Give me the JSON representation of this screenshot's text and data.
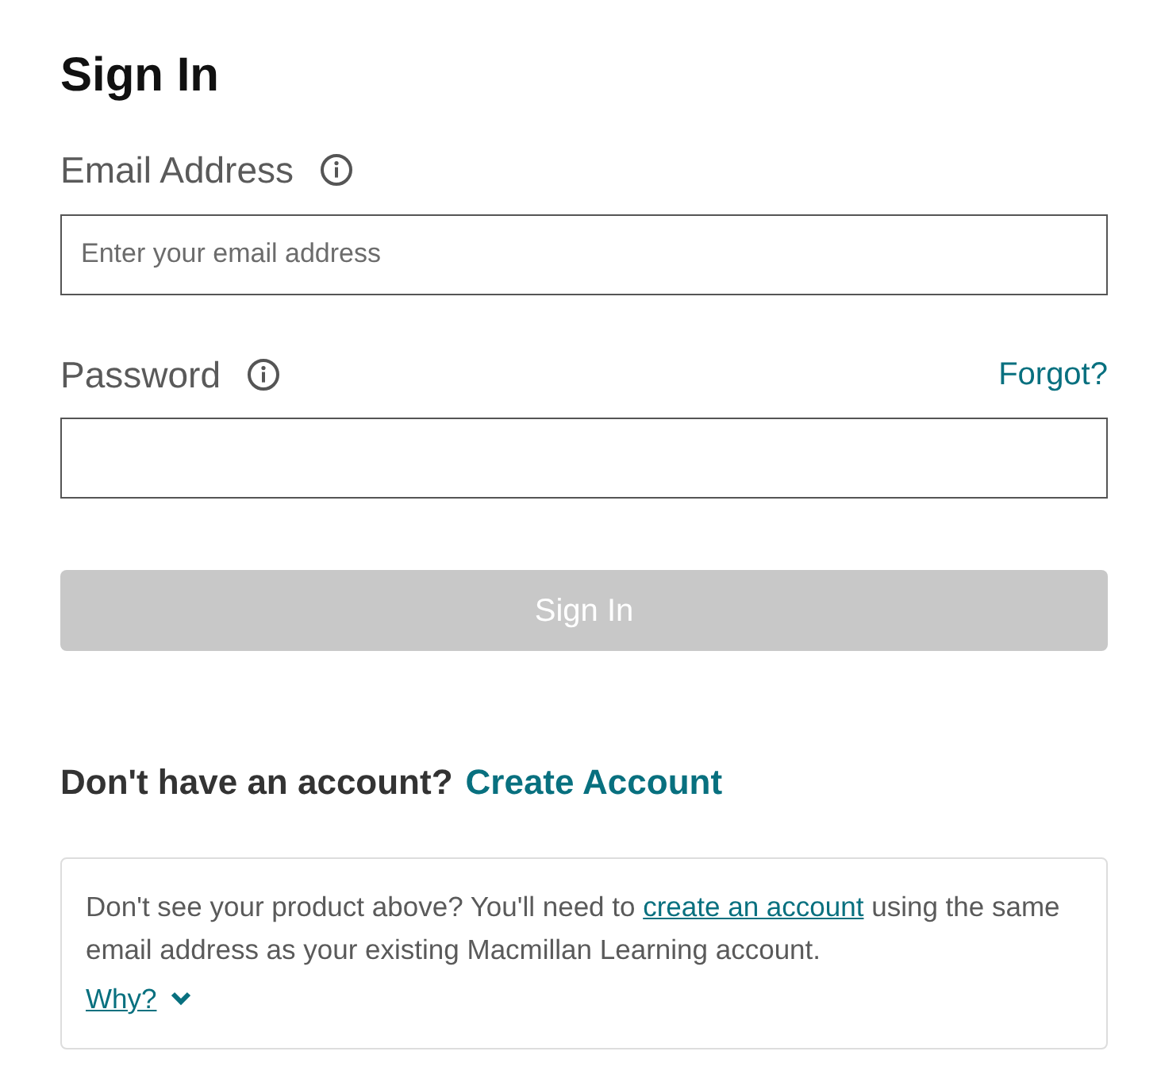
{
  "title": "Sign In",
  "fields": [
    {
      "label": "Email Address",
      "placeholder": "Enter your email address"
    },
    {
      "label": "Password",
      "link": "Forgot?"
    }
  ],
  "submit": {
    "label": "Sign In",
    "disabled": true
  },
  "signup": {
    "prompt": "Don't have an account?",
    "link": "Create Account"
  },
  "note": {
    "before": "Don't see your product above? You'll need to ",
    "link": "create an account",
    "after": " using the same email address as your existing Macmillan Learning account.",
    "toggle": {
      "label": "Why?",
      "expanded": false
    }
  }
}
